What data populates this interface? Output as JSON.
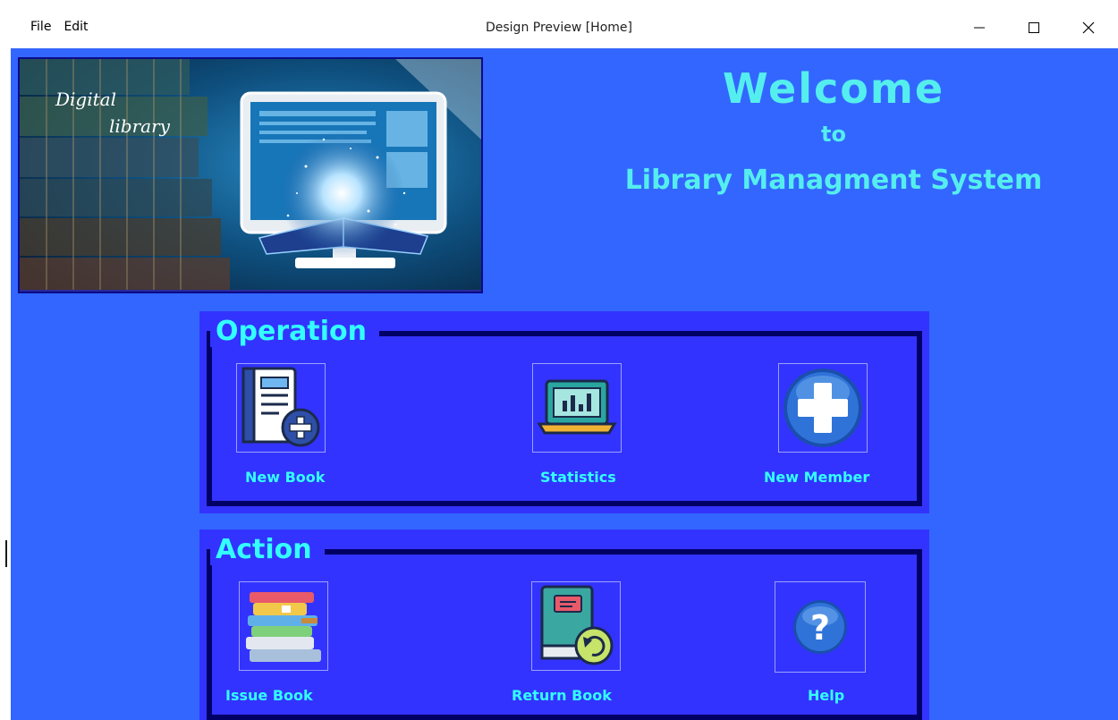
{
  "window": {
    "title": "Design Preview [Home]",
    "menu": [
      "File",
      "Edit"
    ]
  },
  "banner": {
    "line1": "Digital",
    "line2": "library"
  },
  "welcome": {
    "line1": "Welcome",
    "line2": "to",
    "line3": "Library Managment System"
  },
  "operation": {
    "legend": "Operation",
    "buttons": [
      {
        "label": "New Book",
        "icon": "new-book-icon"
      },
      {
        "label": "Statistics",
        "icon": "statistics-icon"
      },
      {
        "label": "New Member",
        "icon": "add-member-icon"
      }
    ]
  },
  "action": {
    "legend": "Action",
    "buttons": [
      {
        "label": "Issue Book",
        "icon": "book-stack-icon"
      },
      {
        "label": "Return Book",
        "icon": "return-book-icon"
      },
      {
        "label": "Help",
        "icon": "help-icon"
      }
    ]
  },
  "colors": {
    "background": "#3366ff",
    "panel": "#3333ff",
    "frame": "#000066",
    "accent_text": "#33ffff",
    "welcome_text": "#55eeee"
  }
}
